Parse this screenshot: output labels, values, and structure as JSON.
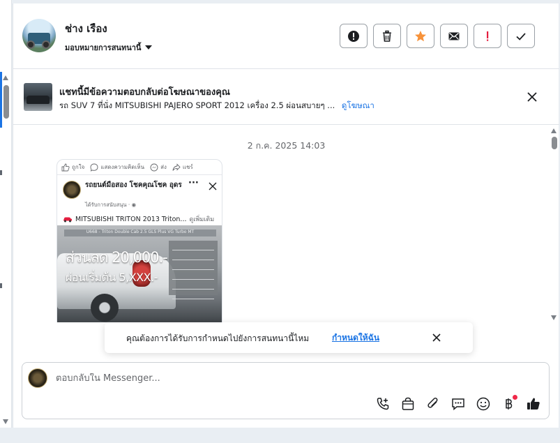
{
  "header": {
    "contact_name": "ช่าง เรือง",
    "assign_label": "มอบหมายการสนทนานี้"
  },
  "ad_reply": {
    "title": "แชทนี้มีข้อความตอบกลับต่อโฆษณาของคุณ",
    "subtitle": "รถ SUV 7 ที่นั่ง MITSUBISHI PAJERO SPORT 2012 เครื่อง 2.5 ผ่อนสบายๆ ...",
    "view_ad_link": "ดูโฆษณา"
  },
  "chat": {
    "date_label": "2 ก.ค. 2025 14:03",
    "post": {
      "actions": [
        "ถูกใจ",
        "แสดงความคิดเห็น",
        "ส่ง",
        "แชร์"
      ],
      "page_name": "รถยนต์มือสอง โชคคุณโชค อุดร",
      "sponsored": "ได้รับการสนับสนุน · ",
      "text": "MITSUBISHI TRITON 2013 Triton...",
      "see_more": "ดูเพิ่มเติม",
      "image_caption": "U668 - Triton Double Cab 2.5 GLS Plus VG Turbo MT",
      "promo_line1": "ส่วนลด 20,000.-",
      "promo_line2": "ผ่อนเริ่มต้น 5,XXX.-"
    }
  },
  "toast": {
    "question": "คุณต้องการได้รับการกำหนดไปยังการสนทนานี้ไหม",
    "assign_me": "กำหนดให้ฉัน"
  },
  "composer": {
    "placeholder": "ตอบกลับใน Messenger..."
  },
  "icons": {
    "report": "exclamation-circle-icon",
    "delete": "trash-icon",
    "star": "star-icon",
    "mail": "envelope-icon",
    "spam": "exclamation-icon",
    "done": "check-icon"
  },
  "colors": {
    "accent": "#1b74e4",
    "star": "#f7923a",
    "spam": "#e41e3f",
    "badge": "#f02849"
  }
}
